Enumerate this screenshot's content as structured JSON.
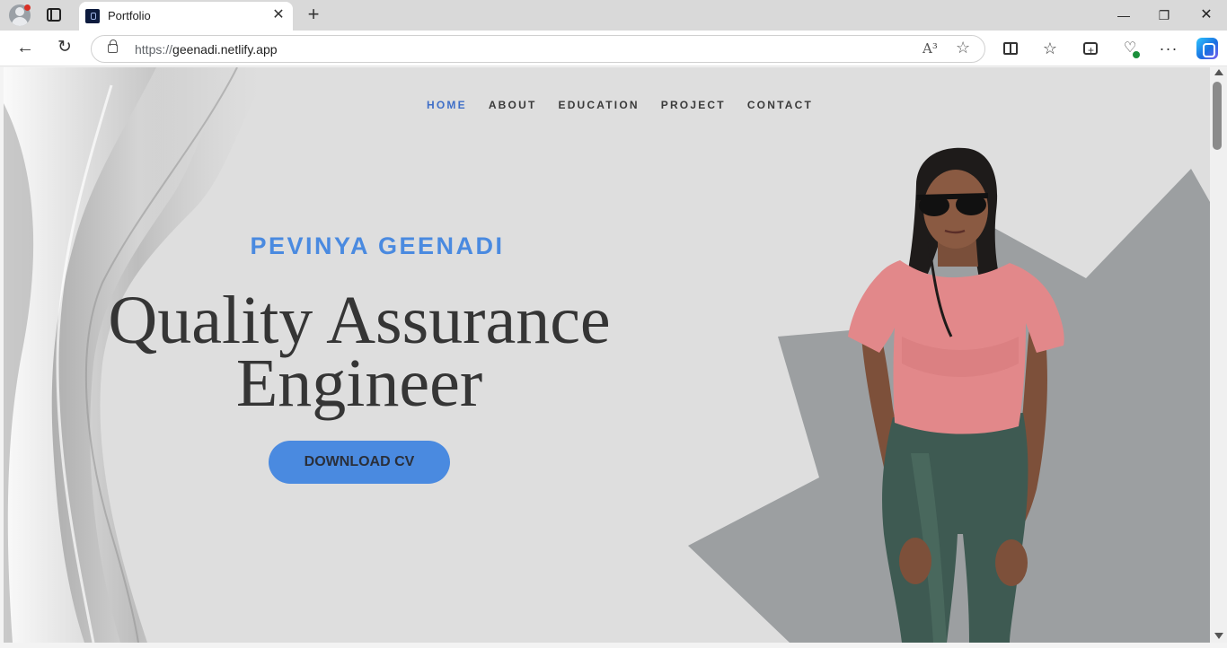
{
  "browser": {
    "tab_title": "Portfolio",
    "tab_close": "✕",
    "new_tab": "+",
    "url_scheme": "https://",
    "url_host": "geenadi.netlify.app",
    "window_min": "—",
    "window_max": "❐",
    "window_close": "✕",
    "more": "···",
    "read_aloud": "A³",
    "back": "←",
    "reload": "↻"
  },
  "page": {
    "nav": [
      "HOME",
      "ABOUT",
      "EDUCATION",
      "PROJECT",
      "CONTACT"
    ],
    "active_nav": "HOME",
    "name": "PEVINYA GEENADI",
    "title": "Quality Assurance Engineer",
    "cv_button": "DOWNLOAD CV"
  },
  "colors": {
    "accent": "#4a8ae0",
    "nav_active": "#3f6fc7",
    "page_bg": "#dedede",
    "star_shape": "#9c9fa1",
    "text_dark": "#353535"
  },
  "icons": {
    "profile": "profile-avatar-icon",
    "tabs": "tab-actions-icon",
    "lock": "lock-icon",
    "read_aloud": "read-aloud-icon",
    "favorite": "star-icon",
    "split": "split-screen-icon",
    "favorites": "favorites-icon",
    "collections": "collections-icon",
    "performance": "browser-essentials-icon",
    "copilot": "copilot-icon"
  }
}
